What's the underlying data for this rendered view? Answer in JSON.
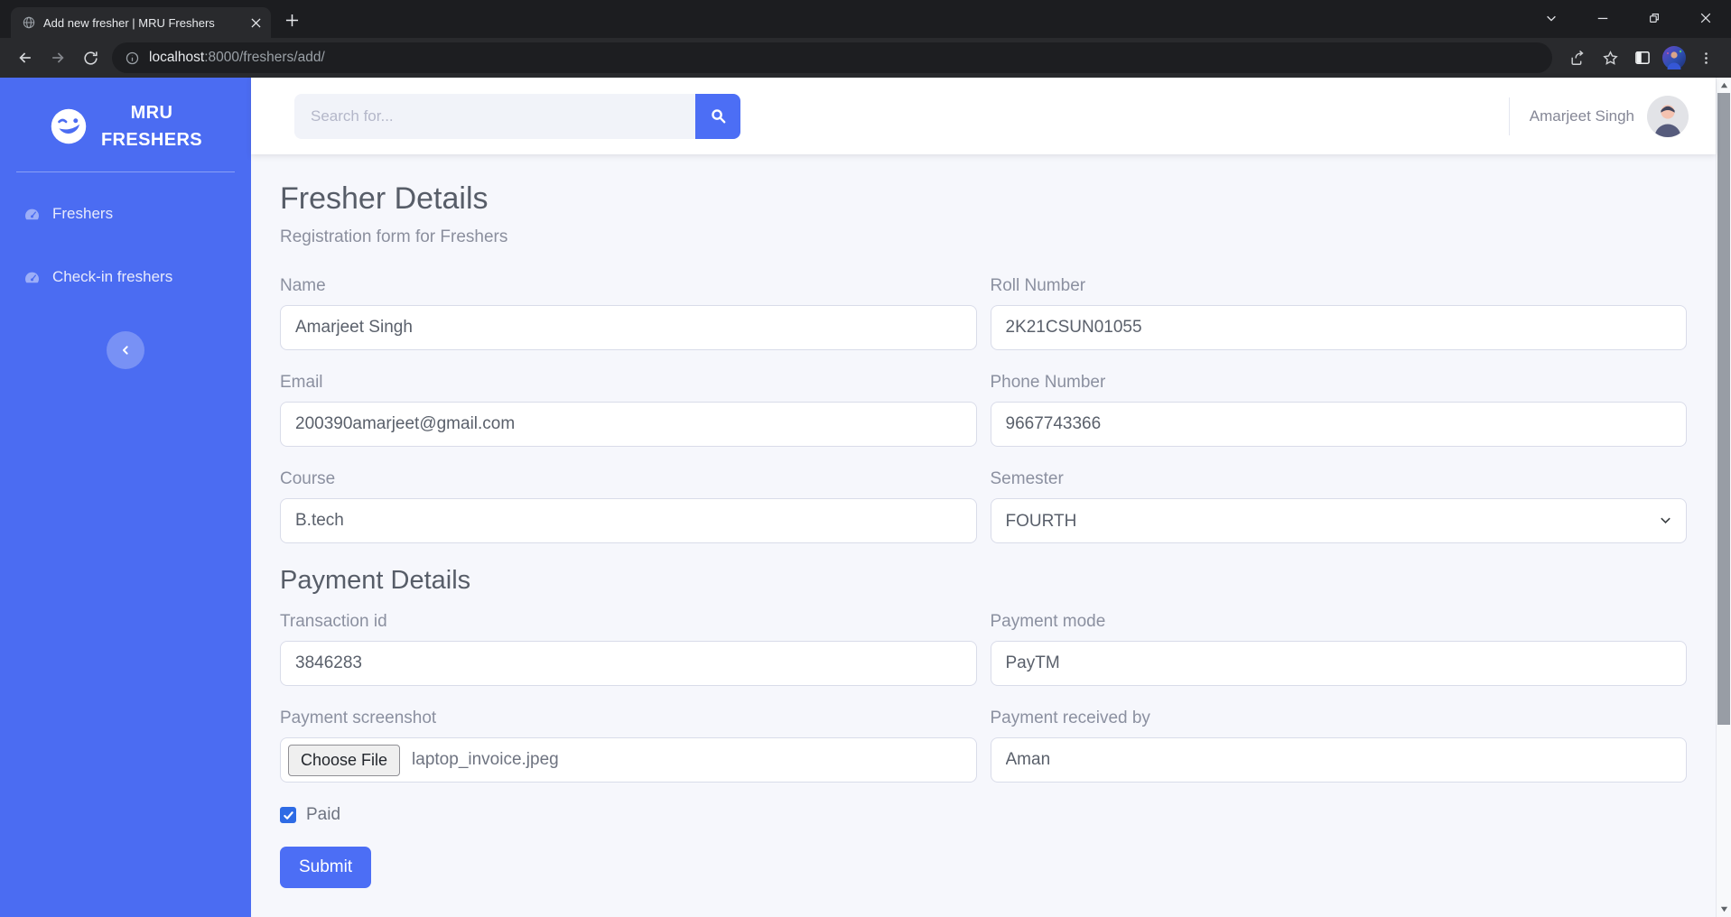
{
  "browser": {
    "tab_title": "Add new fresher | MRU Freshers",
    "url_host": "localhost",
    "url_path": ":8000/freshers/add/"
  },
  "sidebar": {
    "brand_line1": "MRU",
    "brand_line2": "FRESHERS",
    "items": [
      {
        "label": "Freshers"
      },
      {
        "label": "Check-in freshers"
      }
    ]
  },
  "topbar": {
    "search_placeholder": "Search for...",
    "user_name": "Amarjeet Singh"
  },
  "page": {
    "title": "Fresher Details",
    "subtitle": "Registration form for Freshers",
    "payment_heading": "Payment Details",
    "fields": {
      "name": {
        "label": "Name",
        "value": "Amarjeet Singh"
      },
      "roll": {
        "label": "Roll Number",
        "value": "2K21CSUN01055"
      },
      "email": {
        "label": "Email",
        "value": "200390amarjeet@gmail.com"
      },
      "phone": {
        "label": "Phone Number",
        "value": "9667743366"
      },
      "course": {
        "label": "Course",
        "value": "B.tech"
      },
      "semester": {
        "label": "Semester",
        "value": "FOURTH"
      },
      "transaction": {
        "label": "Transaction id",
        "value": "3846283"
      },
      "payment_mode": {
        "label": "Payment mode",
        "value": "PayTM"
      },
      "screenshot": {
        "label": "Payment screenshot",
        "button": "Choose File",
        "filename": "laptop_invoice.jpeg"
      },
      "received_by": {
        "label": "Payment received by",
        "value": "Aman"
      }
    },
    "paid_label": "Paid",
    "paid_checked": true,
    "submit_label": "Submit"
  },
  "colors": {
    "frame": "#1c1d20",
    "toolbar": "#292a2d",
    "urlpill": "#1d1e21",
    "sidebar": "#4b6cf2",
    "accent": "#4c6ef5",
    "content-bg": "#f6f7fc",
    "checkbox": "#2e6be5"
  }
}
